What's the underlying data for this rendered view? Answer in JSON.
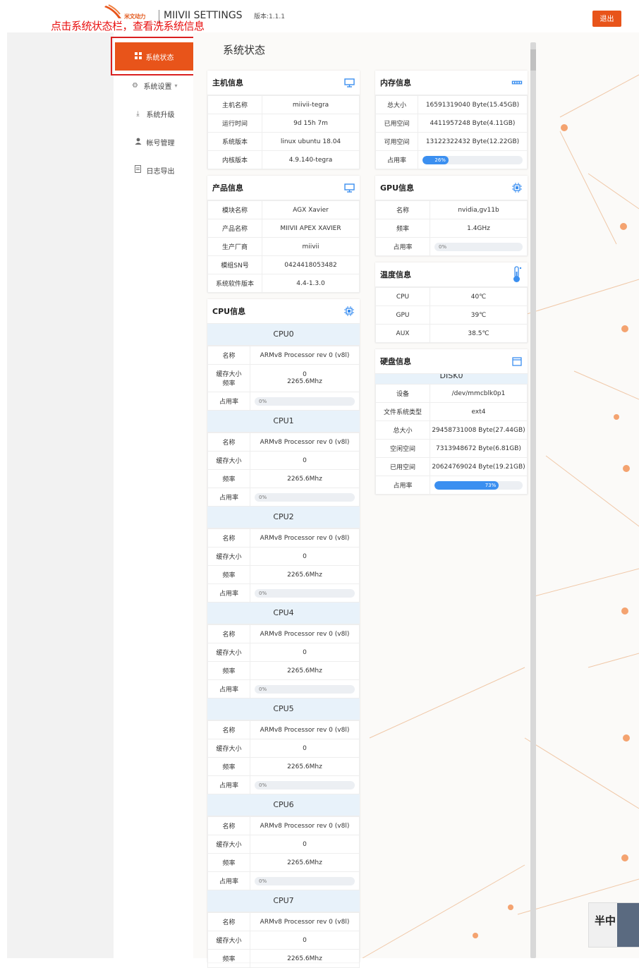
{
  "header": {
    "logo_text": "米文动力",
    "app_title": "MIIVII SETTINGS",
    "version": "版本:1.1.1",
    "logout_label": "退出",
    "annotation": "点击系统状态栏，查看洗系统信息"
  },
  "sidebar": {
    "items": [
      {
        "label": "系统状态",
        "icon": "grid-icon"
      },
      {
        "label": "系统设置",
        "icon": "gear-icon"
      },
      {
        "label": "系统升级",
        "icon": "download-icon"
      },
      {
        "label": "帐号管理",
        "icon": "user-icon"
      },
      {
        "label": "日志导出",
        "icon": "document-icon"
      }
    ]
  },
  "page": {
    "title": "系统状态"
  },
  "host": {
    "title": "主机信息",
    "rows": [
      {
        "k": "主机名称",
        "v": "miivii-tegra"
      },
      {
        "k": "运行时间",
        "v": "9d 15h 7m"
      },
      {
        "k": "系统版本",
        "v": "linux ubuntu 18.04"
      },
      {
        "k": "内核版本",
        "v": "4.9.140-tegra"
      }
    ]
  },
  "product": {
    "title": "产品信息",
    "rows": [
      {
        "k": "模块名称",
        "v": "AGX Xavier"
      },
      {
        "k": "产品名称",
        "v": "MIIVII APEX XAVIER"
      },
      {
        "k": "生产厂商",
        "v": "miivii"
      },
      {
        "k": "模组SN号",
        "v": "0424418053482"
      },
      {
        "k": "系统软件版本",
        "v": "4.4-1.3.0"
      }
    ]
  },
  "memory": {
    "title": "内存信息",
    "rows": [
      {
        "k": "总大小",
        "v": "16591319040 Byte(15.45GB)"
      },
      {
        "k": "已用空间",
        "v": "4411957248 Byte(4.11GB)"
      },
      {
        "k": "可用空间",
        "v": "13122322432 Byte(12.22GB)"
      }
    ],
    "usage_label": "占用率",
    "usage": 26,
    "usage_text": "26%"
  },
  "gpu": {
    "title": "GPU信息",
    "rows": [
      {
        "k": "名称",
        "v": "nvidia,gv11b"
      },
      {
        "k": "频率",
        "v": "1.4GHz"
      }
    ],
    "usage_label": "占用率",
    "usage": 0,
    "usage_text": "0%"
  },
  "temperature": {
    "title": "温度信息",
    "rows": [
      {
        "k": "CPU",
        "v": "40℃"
      },
      {
        "k": "GPU",
        "v": "39℃"
      },
      {
        "k": "AUX",
        "v": "38.5℃"
      }
    ]
  },
  "disk": {
    "title": "硬盘信息",
    "partial_header": "DISK0",
    "rows": [
      {
        "k": "设备",
        "v": "/dev/mmcblk0p1"
      },
      {
        "k": "文件系统类型",
        "v": "ext4"
      },
      {
        "k": "总大小",
        "v": "29458731008 Byte(27.44GB)"
      },
      {
        "k": "空闲空间",
        "v": "7313948672 Byte(6.81GB)"
      },
      {
        "k": "已用空间",
        "v": "20624769024 Byte(19.21GB)"
      }
    ],
    "usage_label": "占用率",
    "usage": 73,
    "usage_text": "73%"
  },
  "cpu": {
    "title": "CPU信息",
    "labels": {
      "name": "名称",
      "cache": "缓存大小",
      "freq": "频率",
      "usage": "占用率"
    },
    "cores": [
      {
        "header": "CPU0",
        "name": "ARMv8 Processor rev 0 (v8l)",
        "cache": "0",
        "freq": "2265.6Mhz",
        "usage": 0,
        "usage_text": "0%",
        "merged": true
      },
      {
        "header": "CPU1",
        "name": "ARMv8 Processor rev 0 (v8l)",
        "cache": "0",
        "freq": "2265.6Mhz",
        "usage": 0,
        "usage_text": "0%"
      },
      {
        "header": "CPU2",
        "name": "ARMv8 Processor rev 0 (v8l)",
        "cache": "0",
        "freq": "2265.6Mhz",
        "usage": 0,
        "usage_text": "0%"
      },
      {
        "header": "CPU4",
        "name": "ARMv8 Processor rev 0 (v8l)",
        "cache": "0",
        "freq": "2265.6Mhz",
        "usage": 0,
        "usage_text": "0%"
      },
      {
        "header": "CPU5",
        "name": "ARMv8 Processor rev 0 (v8l)",
        "cache": "0",
        "freq": "2265.6Mhz",
        "usage": 0,
        "usage_text": "0%"
      },
      {
        "header": "CPU6",
        "name": "ARMv8 Processor rev 0 (v8l)",
        "cache": "0",
        "freq": "2265.6Mhz",
        "usage": 0,
        "usage_text": "0%"
      },
      {
        "header": "CPU7",
        "name": "ARMv8 Processor rev 0 (v8l)",
        "cache": "0",
        "freq": "2265.6Mhz",
        "usage": null,
        "usage_text": null
      }
    ]
  },
  "colors": {
    "accent": "#e8541a",
    "progress": "#3b8ff0",
    "cpu_header": "#e8f2fa",
    "annotation": "#e81010"
  },
  "widget": {
    "text": "半中"
  }
}
